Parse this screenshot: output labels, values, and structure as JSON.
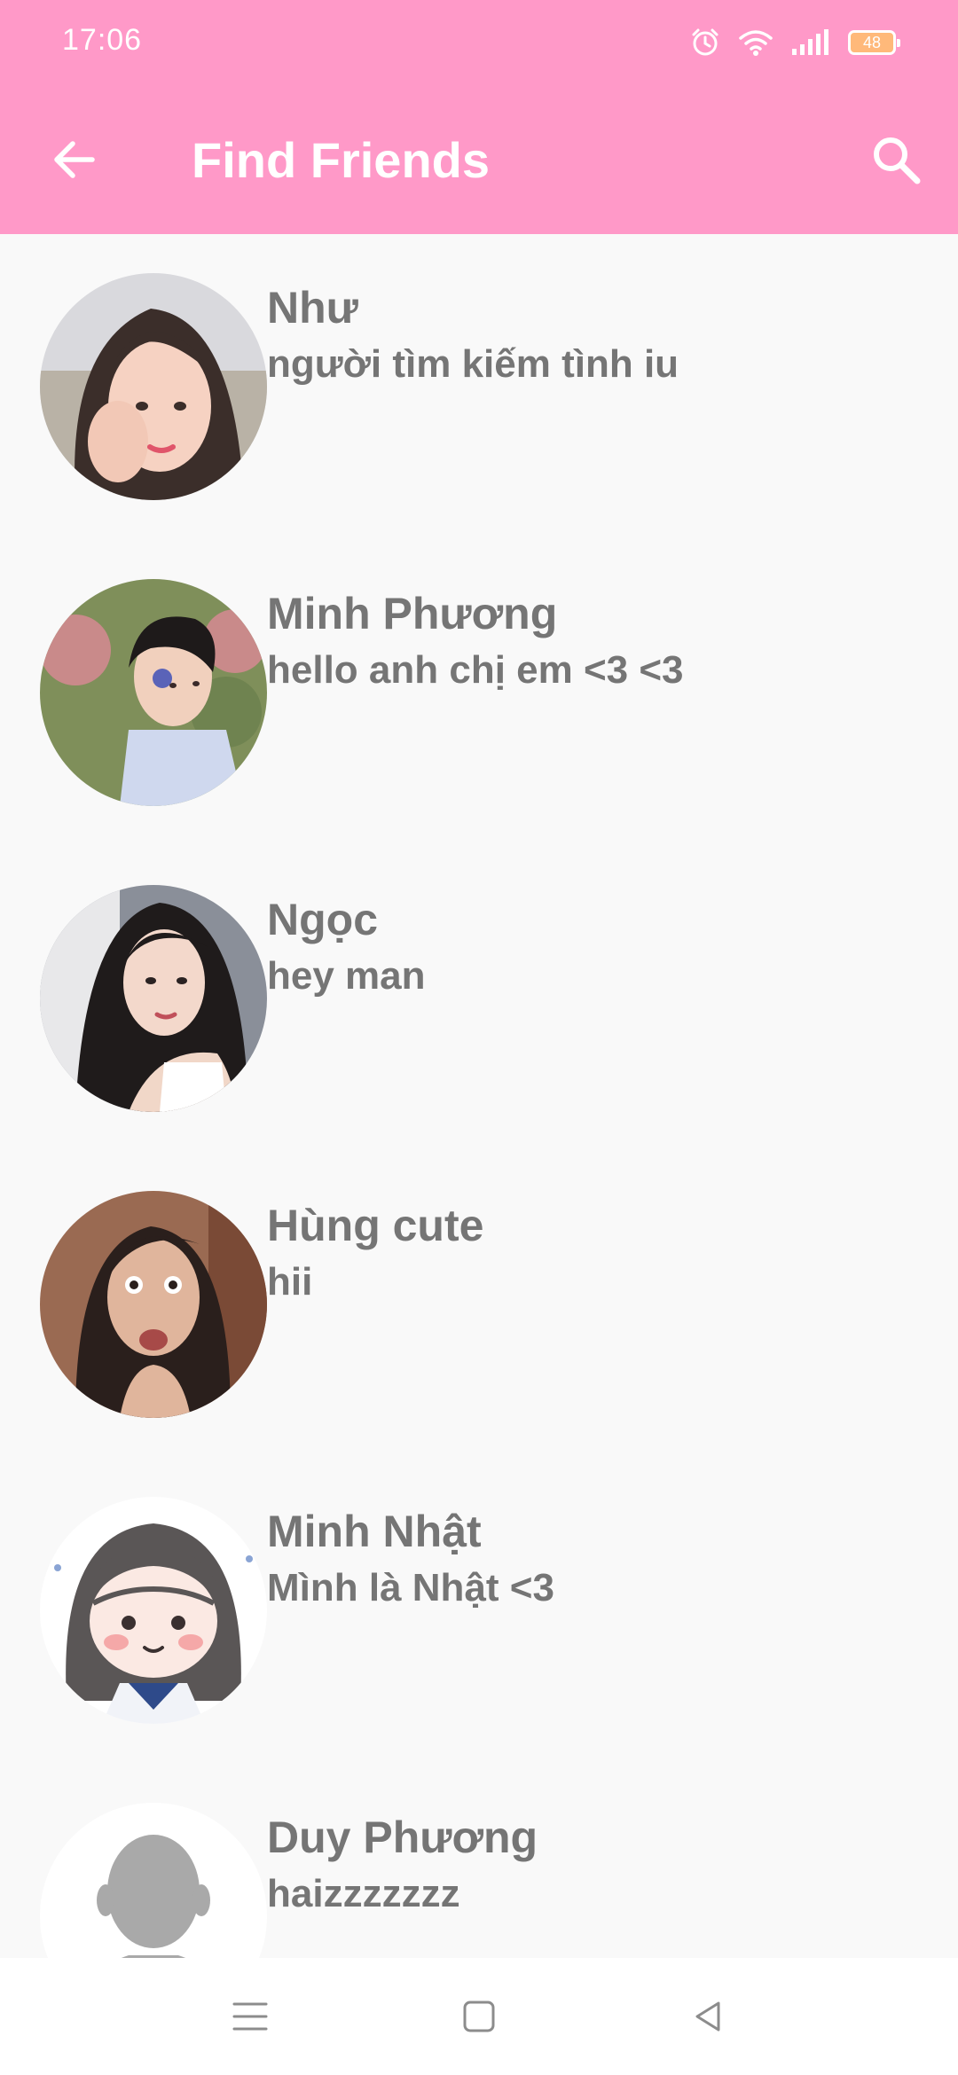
{
  "status_bar": {
    "time": "17:06",
    "battery": "48",
    "icons": [
      "alarm-icon",
      "wifi-icon",
      "signal-icon",
      "battery-icon"
    ]
  },
  "app_bar": {
    "title": "Find Friends",
    "back_icon": "arrow-left-icon",
    "search_icon": "search-icon",
    "background": "#ff99c8"
  },
  "friends": [
    {
      "name": "Như",
      "status": "người tìm kiếm tình iu"
    },
    {
      "name": "Minh Phương",
      "status": "hello anh chị em <3 <3"
    },
    {
      "name": "Ngọc",
      "status": "hey man"
    },
    {
      "name": "Hùng cute",
      "status": "hii"
    },
    {
      "name": "Minh Nhật",
      "status": "Mình là Nhật <3"
    },
    {
      "name": "Duy Phương",
      "status": "haizzzzzzz"
    }
  ],
  "nav_bar": {
    "items": [
      "menu-icon",
      "home-icon",
      "back-icon"
    ]
  },
  "colors": {
    "accent": "#ff99c8",
    "text": "#757575",
    "background": "#f9f9f9"
  }
}
